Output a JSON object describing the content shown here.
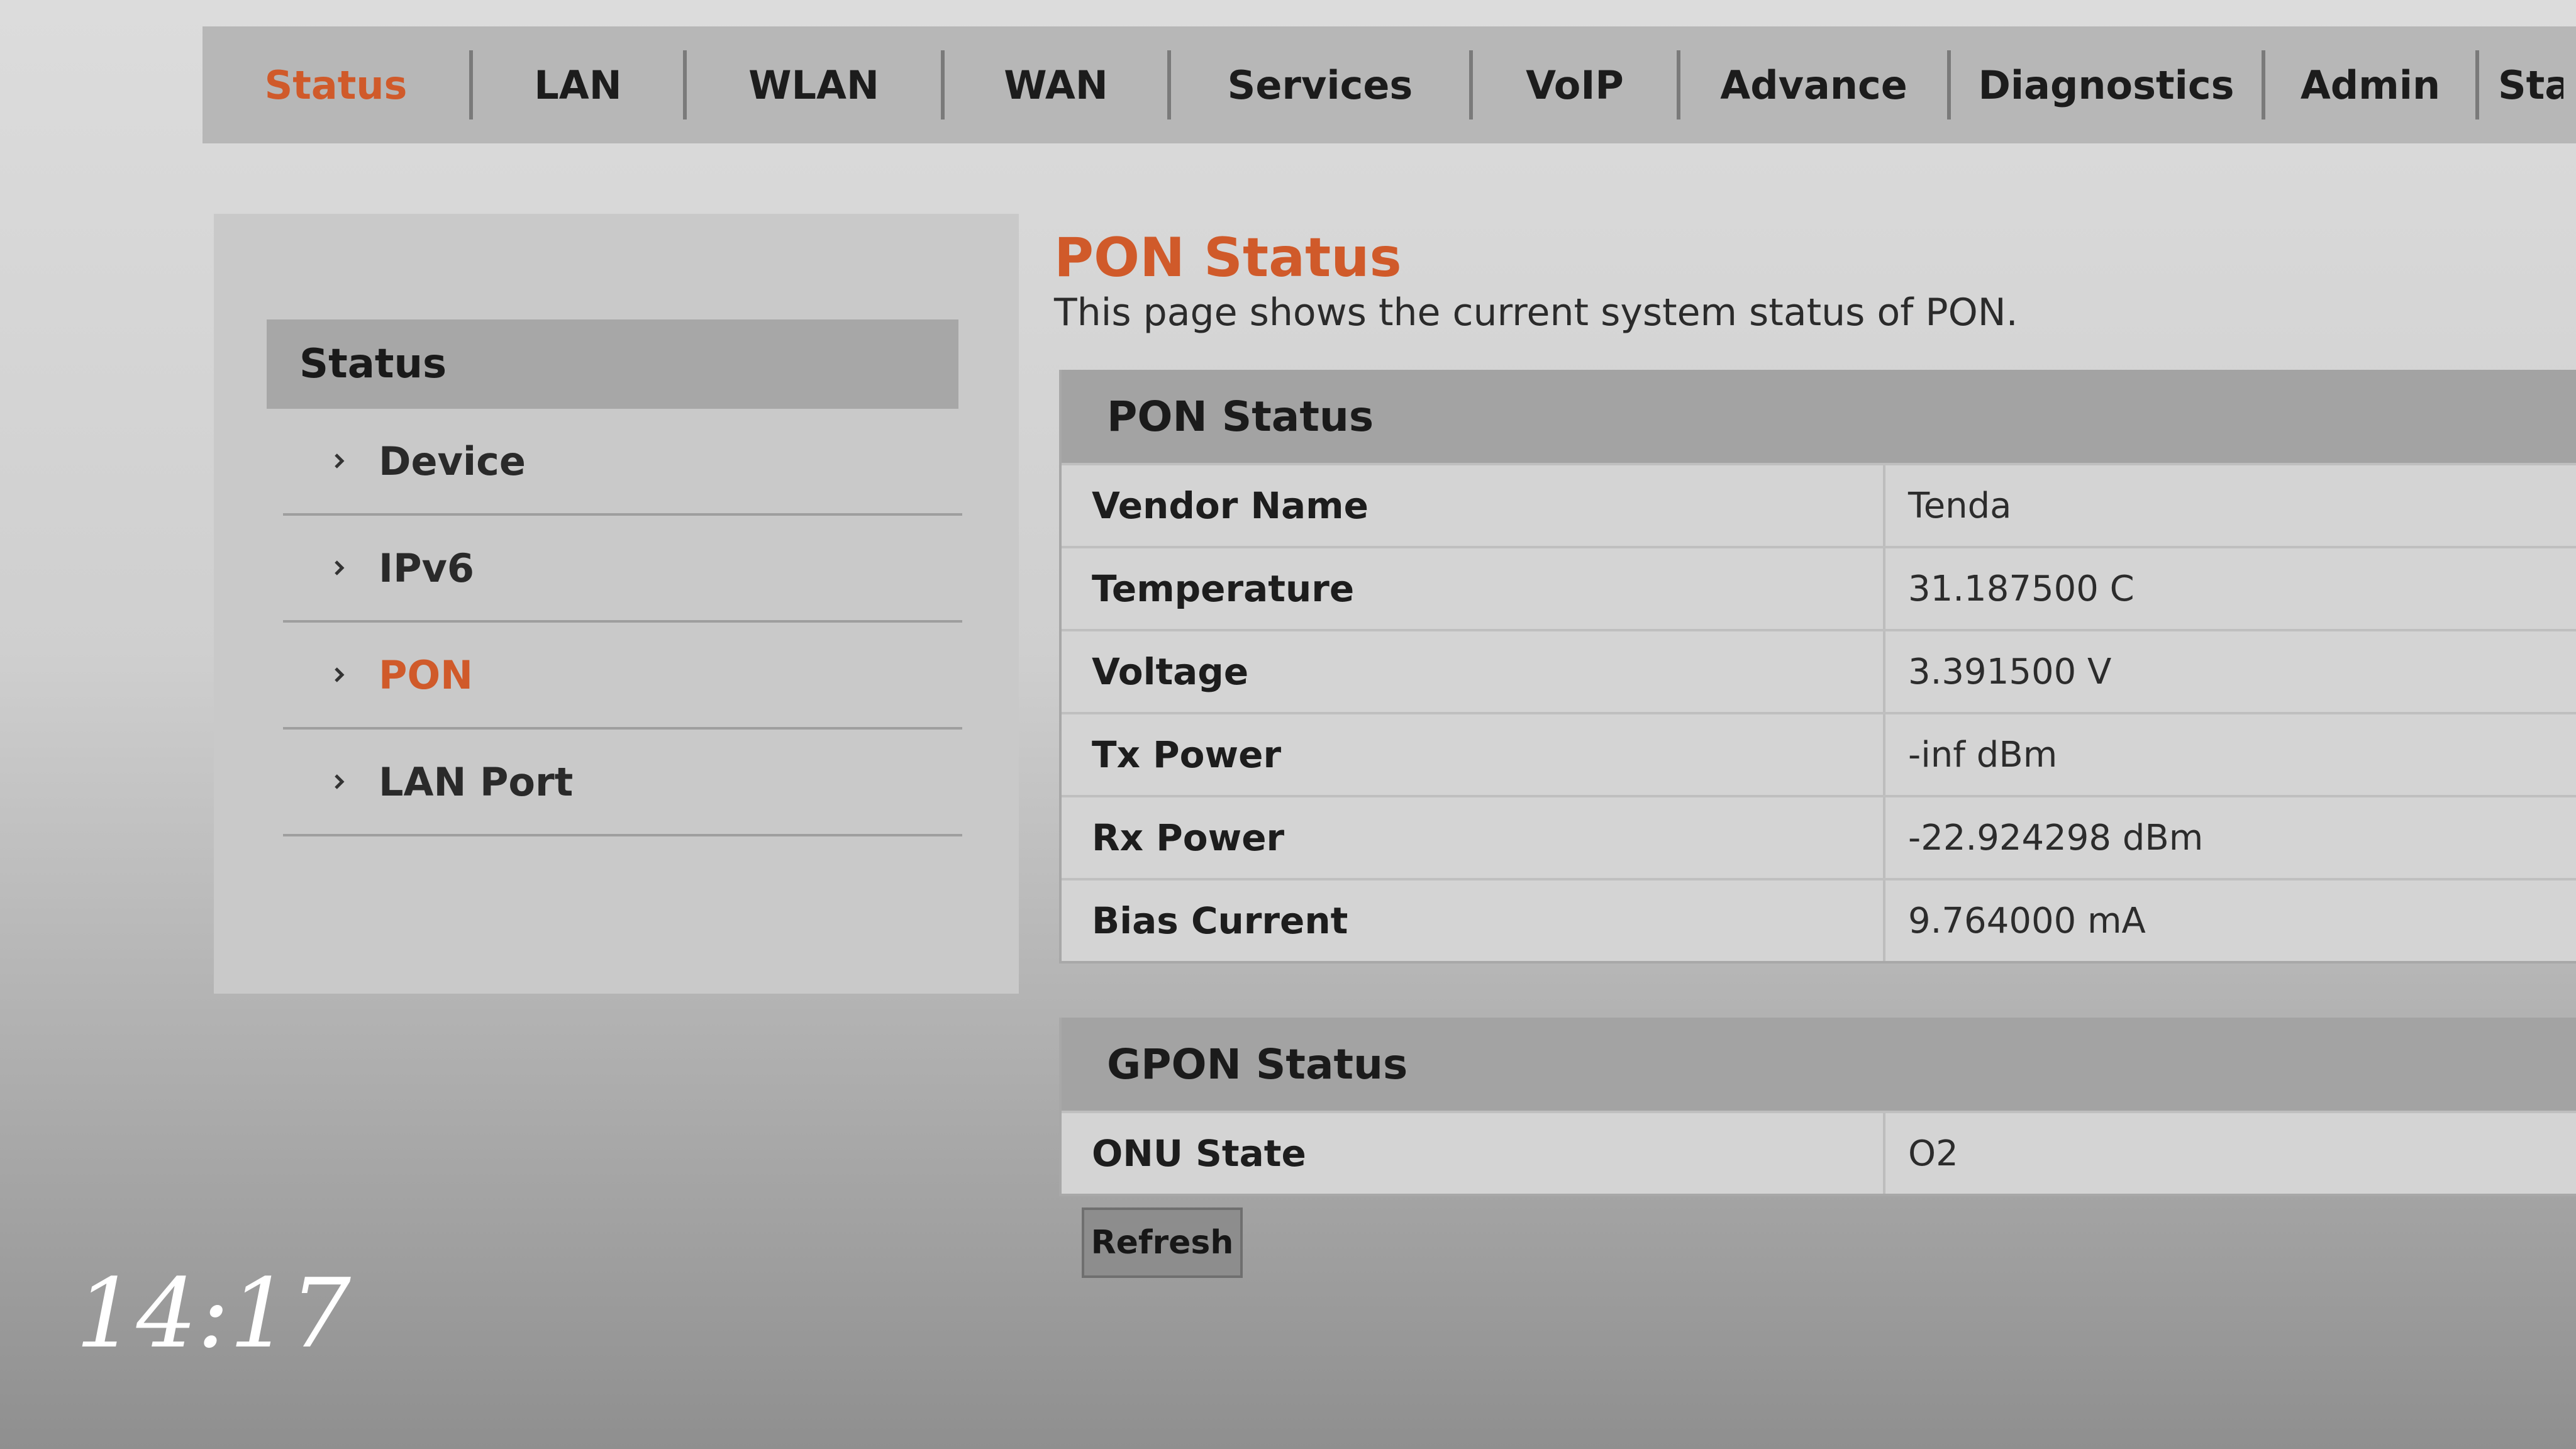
{
  "top_nav": {
    "tabs": [
      {
        "label": "Status",
        "active": true
      },
      {
        "label": "LAN",
        "active": false
      },
      {
        "label": "WLAN",
        "active": false
      },
      {
        "label": "WAN",
        "active": false
      },
      {
        "label": "Services",
        "active": false
      },
      {
        "label": "VoIP",
        "active": false
      },
      {
        "label": "Advance",
        "active": false
      },
      {
        "label": "Diagnostics",
        "active": false
      },
      {
        "label": "Admin",
        "active": false
      },
      {
        "label": "Stat",
        "active": false
      }
    ]
  },
  "sidebar": {
    "header": "Status",
    "items": [
      {
        "label": "Device",
        "active": false
      },
      {
        "label": "IPv6",
        "active": false
      },
      {
        "label": "PON",
        "active": true
      },
      {
        "label": "LAN Port",
        "active": false
      }
    ]
  },
  "main": {
    "title": "PON Status",
    "description": "This page shows the current system status of PON.",
    "pon_status": {
      "heading": "PON Status",
      "rows": [
        {
          "key": "Vendor Name",
          "value": "Tenda"
        },
        {
          "key": "Temperature",
          "value": "31.187500 C"
        },
        {
          "key": "Voltage",
          "value": "3.391500 V"
        },
        {
          "key": "Tx Power",
          "value": "-inf dBm"
        },
        {
          "key": "Rx Power",
          "value": "-22.924298 dBm"
        },
        {
          "key": "Bias Current",
          "value": "9.764000 mA"
        }
      ]
    },
    "gpon_status": {
      "heading": "GPON Status",
      "rows": [
        {
          "key": "ONU State",
          "value": "O2"
        }
      ]
    },
    "refresh_label": "Refresh"
  },
  "overlay": {
    "clock": "14:17"
  },
  "colors": {
    "accent": "#d05a2a",
    "nav_bg": "#b7b7b7",
    "panel_head_bg": "#a3a3a3"
  },
  "icons": {
    "sidebar_chevron": "chevron-right-icon"
  }
}
